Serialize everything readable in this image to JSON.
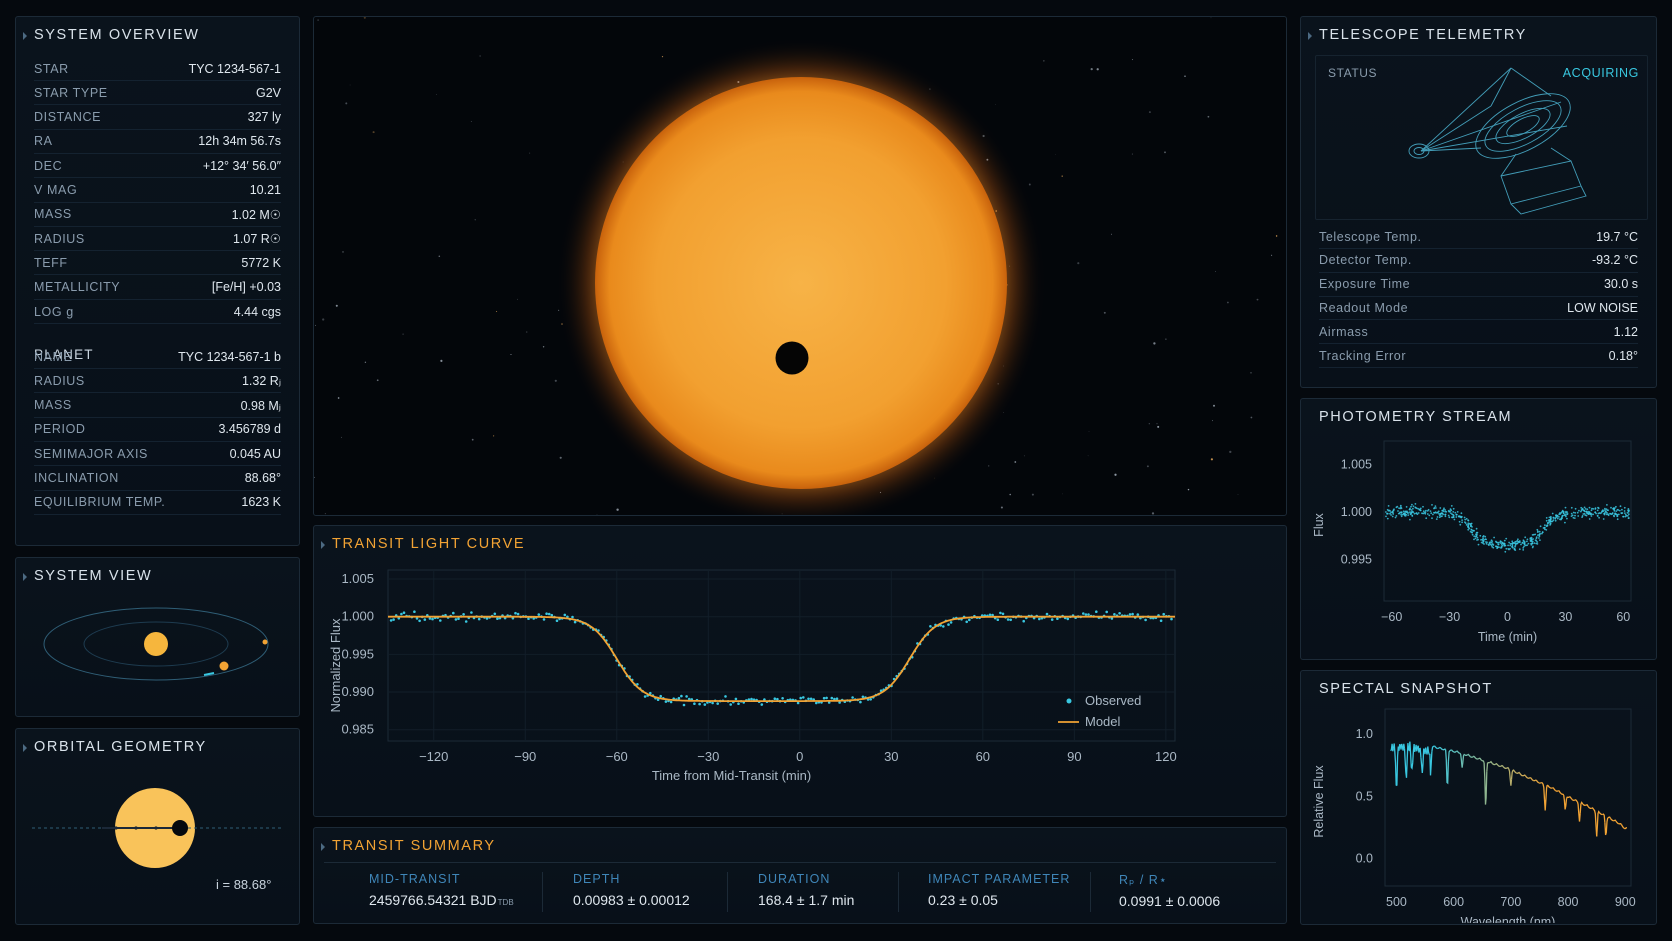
{
  "system_overview": {
    "title": "SYSTEM OVERVIEW",
    "star_rows": [
      {
        "k": "STAR",
        "v": "TYC 1234-567-1"
      },
      {
        "k": "STAR TYPE",
        "v": "G2V"
      },
      {
        "k": "DISTANCE",
        "v": "327 ly"
      },
      {
        "k": "RA",
        "v": "12h 34m 56.7s"
      },
      {
        "k": "DEC",
        "v": "+12° 34′ 56.0″"
      },
      {
        "k": "V MAG",
        "v": "10.21"
      },
      {
        "k": "MASS",
        "v": "1.02 M☉"
      },
      {
        "k": "RADIUS",
        "v": "1.07 R☉"
      },
      {
        "k": "TEFF",
        "v": "5772 K"
      },
      {
        "k": "METALLICITY",
        "v": "[Fe/H] +0.03"
      },
      {
        "k": "LOG g",
        "v": "4.44 cgs"
      }
    ],
    "planet_heading": "PLANET",
    "planet_rows": [
      {
        "k": "NAME",
        "v": "TYC 1234-567-1 b"
      },
      {
        "k": "RADIUS",
        "v": "1.32 Rⱼ"
      },
      {
        "k": "MASS",
        "v": "0.98 Mⱼ"
      },
      {
        "k": "PERIOD",
        "v": "3.456789 d"
      },
      {
        "k": "SEMIMAJOR AXIS",
        "v": "0.045 AU"
      },
      {
        "k": "INCLINATION",
        "v": "88.68°"
      },
      {
        "k": "EQUILIBRIUM TEMP.",
        "v": "1623 K"
      }
    ]
  },
  "system_view": {
    "title": "SYSTEM VIEW"
  },
  "orbital_geometry": {
    "title": "ORBITAL GEOMETRY",
    "inclination_label": "i = 88.68°"
  },
  "telemetry": {
    "title": "TELESCOPE TELEMETRY",
    "status_label": "STATUS",
    "status_value": "ACQUIRING",
    "rows": [
      {
        "k": "Telescope Temp.",
        "v": "19.7 °C"
      },
      {
        "k": "Detector Temp.",
        "v": "-93.2 °C"
      },
      {
        "k": "Exposure Time",
        "v": "30.0 s"
      },
      {
        "k": "Readout Mode",
        "v": "LOW NOISE"
      },
      {
        "k": "Airmass",
        "v": "1.12"
      },
      {
        "k": "Tracking Error",
        "v": "0.18°"
      }
    ]
  },
  "transit_summary": {
    "title": "TRANSIT SUMMARY",
    "cols": [
      {
        "h": "MID-TRANSIT",
        "v": "2459766.54321 BJD",
        "sub": "TDB"
      },
      {
        "h": "DEPTH",
        "v": "0.00983 ± 0.00012",
        "sub": ""
      },
      {
        "h": "DURATION",
        "v": "168.4 ± 1.7 min",
        "sub": ""
      },
      {
        "h": "IMPACT PARAMETER",
        "v": "0.23 ± 0.05",
        "sub": ""
      },
      {
        "h": "Rₚ / R⋆",
        "v": "0.0991 ± 0.0006",
        "sub": ""
      }
    ]
  },
  "colors": {
    "accent_orange": "#f2a334",
    "accent_cyan": "#39c7e0",
    "panel_border": "#1c2a37"
  },
  "chart_data": [
    {
      "id": "transit_light_curve",
      "type": "scatter",
      "title": "TRANSIT LIGHT CURVE",
      "xlabel": "Time from Mid-Transit (min)",
      "ylabel": "Normalized Flux",
      "xlim": [
        -135,
        123
      ],
      "ylim": [
        0.9835,
        1.0062
      ],
      "xticks": [
        -120,
        -90,
        -60,
        -30,
        0,
        30,
        60,
        90,
        120
      ],
      "yticks": [
        1.005,
        1.0,
        0.995,
        0.99,
        0.985
      ],
      "grid": true,
      "legend": "right",
      "series": [
        {
          "name": "Observed",
          "kind": "points",
          "color": "#39c7e0"
        },
        {
          "name": "Model",
          "kind": "line",
          "color": "#f2a334"
        }
      ],
      "model": {
        "baseline": 1.0,
        "depth": 0.0112,
        "ingress_center": -60,
        "egress_center": 36,
        "width": 4.2
      },
      "observed_noise": 0.0009
    },
    {
      "id": "photometry_stream",
      "type": "scatter",
      "title": "PHOTOMETRY STREAM",
      "xlabel": "Time (min)",
      "ylabel": "Flux",
      "xlim": [
        -64,
        64
      ],
      "ylim": [
        0.9906,
        1.0075
      ],
      "xticks": [
        -60,
        -30,
        0,
        30,
        60
      ],
      "yticks": [
        1.005,
        1.0,
        0.995
      ],
      "color": "#39c7e0",
      "model": {
        "baseline": 1.0,
        "depth": 0.0035,
        "ingress_center": -19,
        "egress_center": 19,
        "width": 3.5
      }
    },
    {
      "id": "spectral_snapshot",
      "type": "line",
      "title": "SPECTAL SNAPSHOT",
      "xlabel": "Wavelength (nm)",
      "ylabel": "Relative Flux",
      "xlim": [
        480,
        910
      ],
      "ylim": [
        -0.22,
        1.2
      ],
      "xticks": [
        500,
        600,
        700,
        800,
        900
      ],
      "yticks": [
        1.0,
        0.5,
        0.0
      ],
      "x": [
        490,
        510,
        530,
        550,
        570,
        590,
        610,
        630,
        650,
        670,
        690,
        710,
        730,
        750,
        770,
        790,
        810,
        830,
        850,
        870,
        890,
        900
      ],
      "y": [
        0.95,
        0.96,
        0.95,
        0.93,
        0.9,
        0.88,
        0.86,
        0.83,
        0.8,
        0.77,
        0.74,
        0.7,
        0.66,
        0.62,
        0.58,
        0.53,
        0.48,
        0.44,
        0.39,
        0.34,
        0.29,
        0.25
      ],
      "absorption_lines": [
        {
          "x": 500,
          "depth": 0.35
        },
        {
          "x": 517,
          "depth": 0.28
        },
        {
          "x": 527,
          "depth": 0.22
        },
        {
          "x": 545,
          "depth": 0.2
        },
        {
          "x": 560,
          "depth": 0.18
        },
        {
          "x": 589,
          "depth": 0.3
        },
        {
          "x": 615,
          "depth": 0.12
        },
        {
          "x": 656,
          "depth": 0.38
        },
        {
          "x": 700,
          "depth": 0.12
        },
        {
          "x": 760,
          "depth": 0.2
        },
        {
          "x": 795,
          "depth": 0.12
        },
        {
          "x": 820,
          "depth": 0.15
        },
        {
          "x": 850,
          "depth": 0.2
        },
        {
          "x": 866,
          "depth": 0.16
        }
      ]
    }
  ]
}
